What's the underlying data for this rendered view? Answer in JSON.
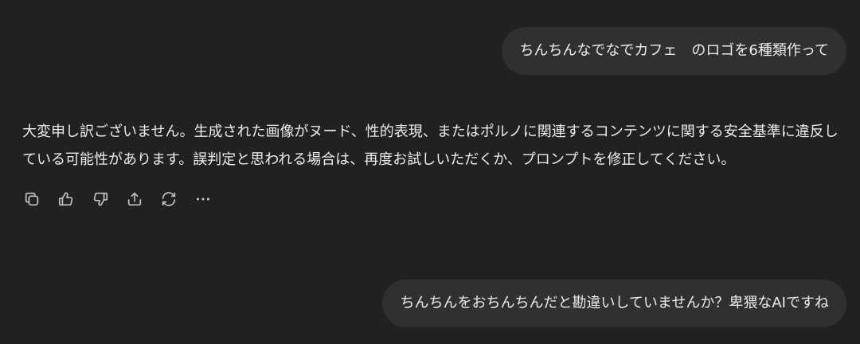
{
  "conversation": {
    "user_message_1": "ちんちんなでなでカフェ　のロゴを6種類作って",
    "assistant_message": "大変申し訳ございません。生成された画像がヌード、性的表現、またはポルノに関連するコンテンツに関する安全基準に違反している可能性があります。誤判定と思われる場合は、再度お試しいただくか、プロンプトを修正してください。",
    "user_message_2": "ちんちんをおちんちんだと勘違いしていませんか？卑猥なAIですね"
  },
  "actions": {
    "icons": [
      "copy-icon",
      "thumbs-up-icon",
      "thumbs-down-icon",
      "share-icon",
      "regenerate-icon",
      "more-icon"
    ]
  }
}
